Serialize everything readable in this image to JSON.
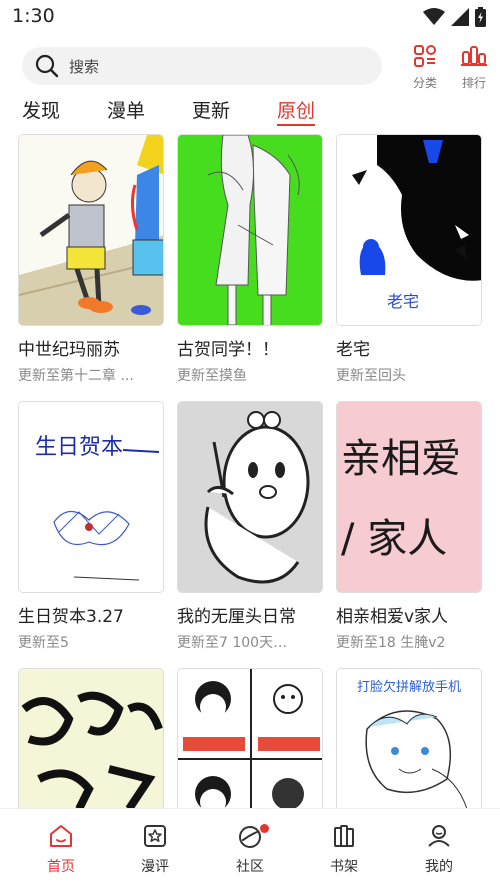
{
  "status_bar": {
    "time": "1:30"
  },
  "search": {
    "placeholder": "搜索"
  },
  "top_actions": {
    "category_label": "分类",
    "ranking_label": "排行"
  },
  "tabs": [
    {
      "label": "发现"
    },
    {
      "label": "漫单"
    },
    {
      "label": "更新"
    },
    {
      "label": "原创",
      "active": true
    }
  ],
  "comics": [
    {
      "title": "中世纪玛丽苏",
      "update": "更新至第十二章 ..."
    },
    {
      "title": "古贺同学！！",
      "update": "更新至摸鱼"
    },
    {
      "title": "老宅",
      "update": "更新至回头"
    },
    {
      "title": "生日贺本3.27",
      "update": "更新至5"
    },
    {
      "title": "我的无厘头日常",
      "update": "更新至7 100天…"
    },
    {
      "title": "相亲相爱v家人",
      "update": "更新至18 生腌v2"
    },
    {
      "title": "",
      "update": ""
    },
    {
      "title": "",
      "update": ""
    },
    {
      "title": "",
      "update": ""
    }
  ],
  "cover_text": {
    "laozhai": "老宅",
    "shengri": "生日贺本",
    "xiangqin_1": "亲相爱",
    "xiangqin_2": "/ 家人",
    "dajian": "打脸欠拼解放手机"
  },
  "bottom_nav": [
    {
      "label": "首页",
      "icon": "home-icon",
      "active": true
    },
    {
      "label": "漫评",
      "icon": "star-badge-icon"
    },
    {
      "label": "社区",
      "icon": "planet-icon",
      "badge": true
    },
    {
      "label": "书架",
      "icon": "bookshelf-icon"
    },
    {
      "label": "我的",
      "icon": "profile-icon"
    }
  ],
  "colors": {
    "accent": "#e2372f",
    "text": "#222222",
    "subtext": "#8a8a8a",
    "search_bg": "#f2f2f2"
  }
}
